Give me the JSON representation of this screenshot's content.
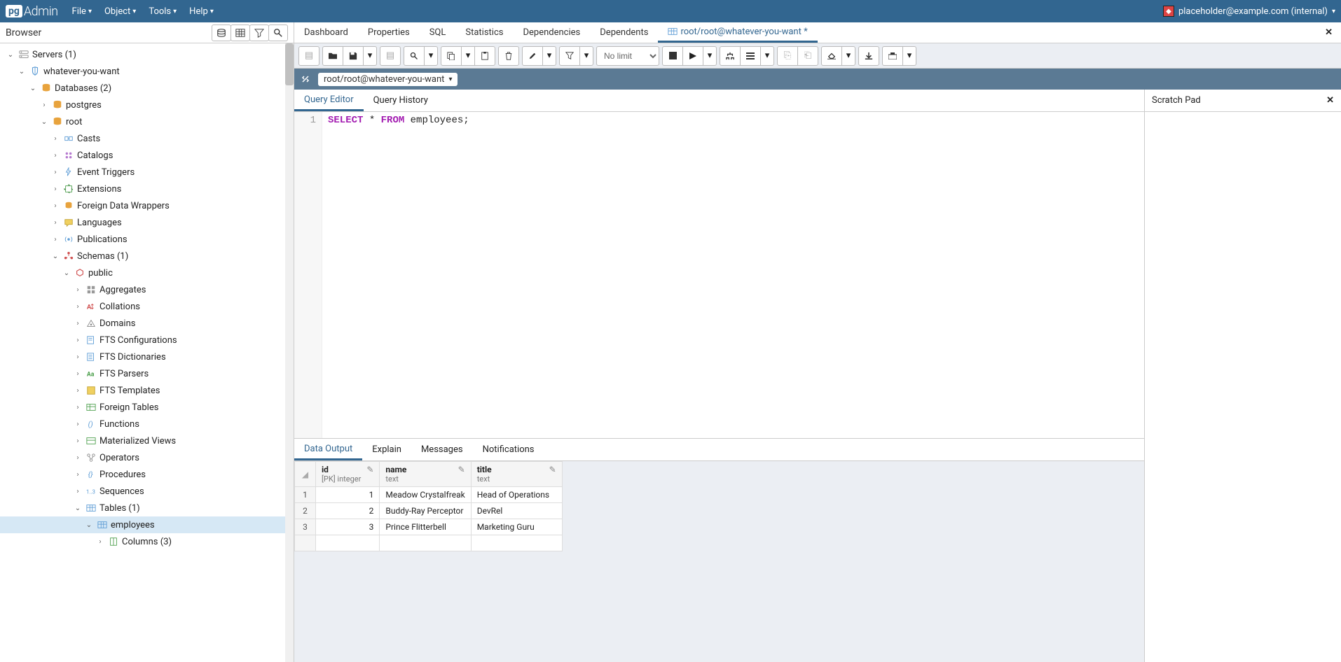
{
  "topbar": {
    "logo_prefix": "pg",
    "logo_suffix": "Admin",
    "menus": [
      "File",
      "Object",
      "Tools",
      "Help"
    ],
    "user": "placeholder@example.com (internal)"
  },
  "sidebar": {
    "title": "Browser",
    "tree": [
      {
        "depth": 0,
        "toggle": "v",
        "icon": "server-group",
        "label": "Servers (1)"
      },
      {
        "depth": 1,
        "toggle": "v",
        "icon": "server",
        "label": "whatever-you-want"
      },
      {
        "depth": 2,
        "toggle": "v",
        "icon": "database-group",
        "label": "Databases (2)"
      },
      {
        "depth": 3,
        "toggle": ">",
        "icon": "database",
        "label": "postgres"
      },
      {
        "depth": 3,
        "toggle": "v",
        "icon": "database",
        "label": "root"
      },
      {
        "depth": 4,
        "toggle": ">",
        "icon": "cast",
        "label": "Casts"
      },
      {
        "depth": 4,
        "toggle": ">",
        "icon": "catalog",
        "label": "Catalogs"
      },
      {
        "depth": 4,
        "toggle": ">",
        "icon": "trigger",
        "label": "Event Triggers"
      },
      {
        "depth": 4,
        "toggle": ">",
        "icon": "extension",
        "label": "Extensions"
      },
      {
        "depth": 4,
        "toggle": ">",
        "icon": "wrapper",
        "label": "Foreign Data Wrappers"
      },
      {
        "depth": 4,
        "toggle": ">",
        "icon": "language",
        "label": "Languages"
      },
      {
        "depth": 4,
        "toggle": ">",
        "icon": "publication",
        "label": "Publications"
      },
      {
        "depth": 4,
        "toggle": "v",
        "icon": "schema-group",
        "label": "Schemas (1)"
      },
      {
        "depth": 5,
        "toggle": "v",
        "icon": "schema",
        "label": "public"
      },
      {
        "depth": 6,
        "toggle": ">",
        "icon": "aggregate",
        "label": "Aggregates"
      },
      {
        "depth": 6,
        "toggle": ">",
        "icon": "collation",
        "label": "Collations"
      },
      {
        "depth": 6,
        "toggle": ">",
        "icon": "domain",
        "label": "Domains"
      },
      {
        "depth": 6,
        "toggle": ">",
        "icon": "fts-config",
        "label": "FTS Configurations"
      },
      {
        "depth": 6,
        "toggle": ">",
        "icon": "fts-dict",
        "label": "FTS Dictionaries"
      },
      {
        "depth": 6,
        "toggle": ">",
        "icon": "fts-parser",
        "label": "FTS Parsers"
      },
      {
        "depth": 6,
        "toggle": ">",
        "icon": "fts-template",
        "label": "FTS Templates"
      },
      {
        "depth": 6,
        "toggle": ">",
        "icon": "foreign-table",
        "label": "Foreign Tables"
      },
      {
        "depth": 6,
        "toggle": ">",
        "icon": "function",
        "label": "Functions"
      },
      {
        "depth": 6,
        "toggle": ">",
        "icon": "mat-view",
        "label": "Materialized Views"
      },
      {
        "depth": 6,
        "toggle": ">",
        "icon": "operator",
        "label": "Operators"
      },
      {
        "depth": 6,
        "toggle": ">",
        "icon": "procedure",
        "label": "Procedures"
      },
      {
        "depth": 6,
        "toggle": ">",
        "icon": "sequence",
        "label": "Sequences"
      },
      {
        "depth": 6,
        "toggle": "v",
        "icon": "table-group",
        "label": "Tables (1)"
      },
      {
        "depth": 7,
        "toggle": "v",
        "icon": "table",
        "label": "employees",
        "selected": true
      },
      {
        "depth": 8,
        "toggle": ">",
        "icon": "column",
        "label": "Columns (3)"
      }
    ]
  },
  "content_tabs": {
    "items": [
      "Dashboard",
      "Properties",
      "SQL",
      "Statistics",
      "Dependencies",
      "Dependents"
    ],
    "active": "root/root@whatever-you-want *"
  },
  "toolbar": {
    "no_limit": "No limit"
  },
  "connection": {
    "text": "root/root@whatever-you-want"
  },
  "editor": {
    "tabs": [
      "Query Editor",
      "Query History"
    ],
    "active": 0,
    "line_no": "1",
    "sql_kw1": "SELECT",
    "sql_star": " * ",
    "sql_kw2": "FROM",
    "sql_rest": " employees;"
  },
  "scratch": {
    "title": "Scratch Pad"
  },
  "output": {
    "tabs": [
      "Data Output",
      "Explain",
      "Messages",
      "Notifications"
    ],
    "active": 0,
    "columns": [
      {
        "name": "id",
        "type": "[PK] integer"
      },
      {
        "name": "name",
        "type": "text"
      },
      {
        "name": "title",
        "type": "text"
      }
    ],
    "rows": [
      {
        "n": "1",
        "id": "1",
        "name": "Meadow Crystalfreak",
        "title": "Head of Operations"
      },
      {
        "n": "2",
        "id": "2",
        "name": "Buddy-Ray Perceptor",
        "title": "DevRel"
      },
      {
        "n": "3",
        "id": "3",
        "name": "Prince Flitterbell",
        "title": "Marketing Guru"
      }
    ]
  }
}
